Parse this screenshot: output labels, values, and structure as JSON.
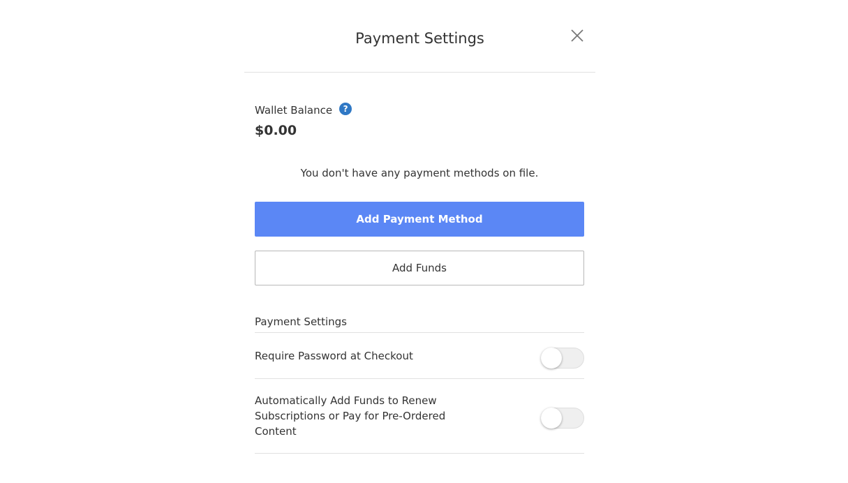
{
  "dialog": {
    "title": "Payment Settings",
    "close_icon": "close-icon"
  },
  "wallet": {
    "label": "Wallet Balance",
    "help_icon": "question-circle-icon",
    "help_glyph": "?",
    "help_color": "#2f78c5",
    "amount": "$0.00"
  },
  "payment_methods": {
    "empty_message": "You don't have any payment methods on file.",
    "add_method_label": "Add Payment Method",
    "add_method_color": "#5b87f5",
    "add_funds_label": "Add Funds"
  },
  "settings": {
    "heading": "Payment Settings",
    "items": [
      {
        "label": "Require Password at Checkout",
        "enabled": false
      },
      {
        "label": "Automatically Add Funds to Renew Subscriptions or Pay for Pre-Ordered Content",
        "enabled": false
      }
    ]
  }
}
